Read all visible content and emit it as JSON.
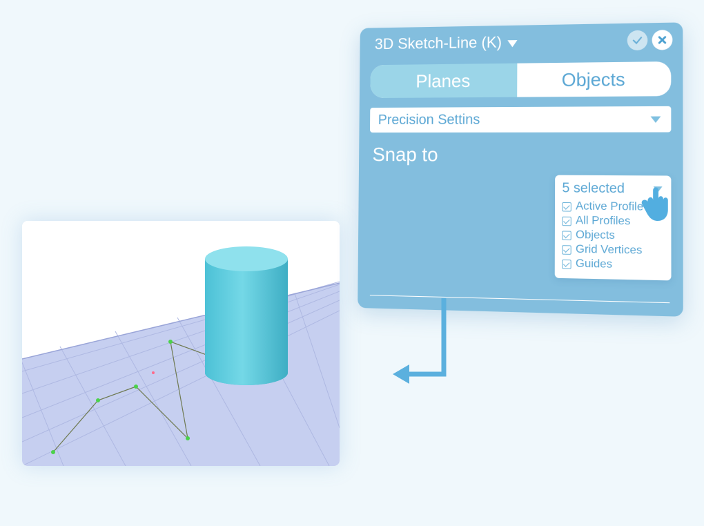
{
  "panel": {
    "title": "3D Sketch-Line (K)",
    "tabs": {
      "planes": "Planes",
      "objects": "Objects",
      "active": "planes"
    },
    "precision_label": "Precision Settins",
    "snap_label": "Snap to",
    "snap_selected": "5 selected",
    "snap_options": [
      {
        "label": "Active Profile",
        "checked": true
      },
      {
        "label": "All Profiles",
        "checked": true
      },
      {
        "label": "Objects",
        "checked": true
      },
      {
        "label": "Grid Vertices",
        "checked": true
      },
      {
        "label": "Guides",
        "checked": true
      }
    ]
  },
  "colors": {
    "panel_bg": "#83bede",
    "accent": "#5ba7d4",
    "light": "#9bd5e8"
  }
}
